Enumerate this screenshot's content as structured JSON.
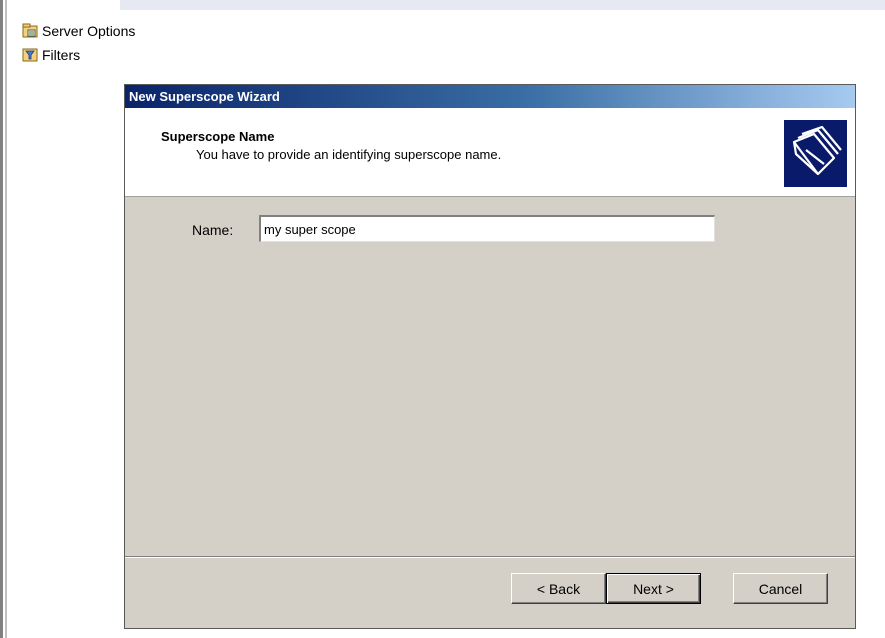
{
  "tree": {
    "items": [
      {
        "label": "Server Options",
        "icon": "server-options-icon"
      },
      {
        "label": "Filters",
        "icon": "filter-icon"
      }
    ]
  },
  "wizard": {
    "title": "New Superscope Wizard",
    "header_title": "Superscope Name",
    "header_subtitle": "You have to provide an identifying superscope name.",
    "header_icon": "folders-icon",
    "name_label": "Name:",
    "name_value": "my super scope",
    "buttons": {
      "back": "< Back",
      "next": "Next >",
      "cancel": "Cancel"
    }
  },
  "colors": {
    "titlebar_start": "#0a246a",
    "titlebar_end": "#a6caf0",
    "dialog_bg": "#d4d0c8"
  }
}
